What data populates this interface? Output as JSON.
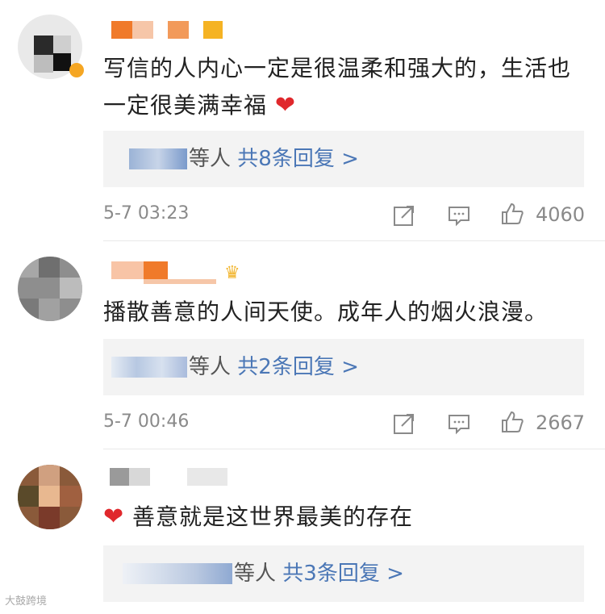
{
  "comments": [
    {
      "text": "写信的人内心一定是很温柔和强大的，生活也一定很美满幸福",
      "emoji": "❤",
      "reply": {
        "who": "等人",
        "count_text": "共8条回复 >"
      },
      "time": "5-7 03:23",
      "likes": "4060"
    },
    {
      "text": "播散善意的人间天使。成年人的烟火浪漫。",
      "reply": {
        "who": "等人",
        "count_text": "共2条回复 >"
      },
      "time": "5-7 00:46",
      "likes": "2667"
    },
    {
      "emoji": "❤",
      "text": "善意就是这世界最美的存在",
      "reply": {
        "who": "等人",
        "count_text": "共3条回复 >"
      }
    }
  ],
  "watermark": "大鼓跨境",
  "icons": [
    "share-icon",
    "comment-icon",
    "like-icon",
    "crown-icon",
    "heart-icon"
  ],
  "colors": {
    "link": "#4b77b6",
    "heart": "#e0282c",
    "meta": "#8a8a8a",
    "reply_bg": "#f3f3f3"
  }
}
